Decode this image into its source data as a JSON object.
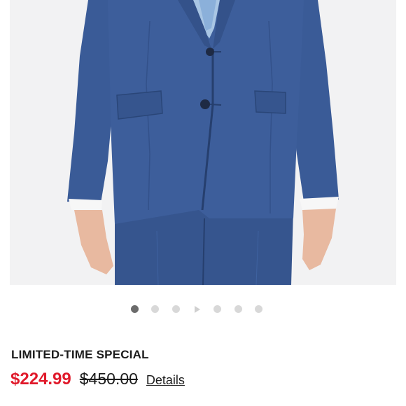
{
  "product": {
    "image_icon": "suit-jacket-photo",
    "colors": {
      "suit": "#3b5b96",
      "suit_dark": "#263f6e",
      "background": "#f2f2f3",
      "sale_red": "#e01a2b"
    }
  },
  "carousel": {
    "active_index": 0,
    "slides": [
      {
        "type": "dot"
      },
      {
        "type": "dot"
      },
      {
        "type": "dot"
      },
      {
        "type": "video",
        "icon": "play-icon"
      },
      {
        "type": "dot"
      },
      {
        "type": "dot"
      },
      {
        "type": "dot"
      }
    ]
  },
  "offer": {
    "promo_label": "LIMITED-TIME SPECIAL",
    "sale_price": "$224.99",
    "original_price": "$450.00",
    "details_label": "Details"
  }
}
